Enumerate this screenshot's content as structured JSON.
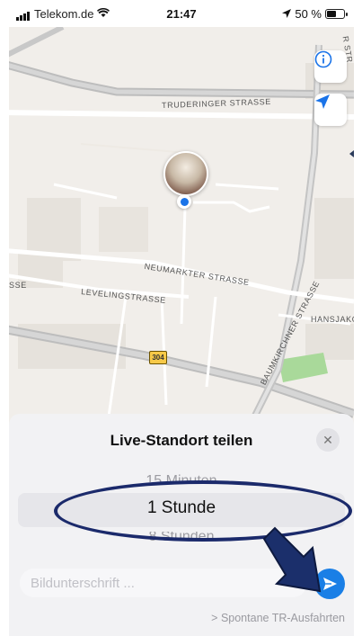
{
  "status_bar": {
    "carrier": "Telekom.de",
    "time": "21:47",
    "battery": "50 %"
  },
  "map": {
    "streets": {
      "truderinger": "TRUDERINGER STRASSE",
      "neumarkter": "NEUMARKTER STRASSE",
      "levelings": "LEVELINGSTRASSE",
      "baumkirchner": "BAUMKIRCHNER STRASSE",
      "hansjakob": "HANSJAKOB",
      "left_fragment": "SSE",
      "top_right_fragment": "R STR"
    },
    "road_number": "304"
  },
  "sheet": {
    "title": "Live-Standort teilen",
    "close_symbol": "✕",
    "picker": {
      "above": "15 Minuten",
      "selected": "1 Stunde",
      "below": "8 Stunden"
    },
    "caption_placeholder": "Bildunterschrift ...",
    "link": "> Spontane TR-Ausfahrten"
  }
}
